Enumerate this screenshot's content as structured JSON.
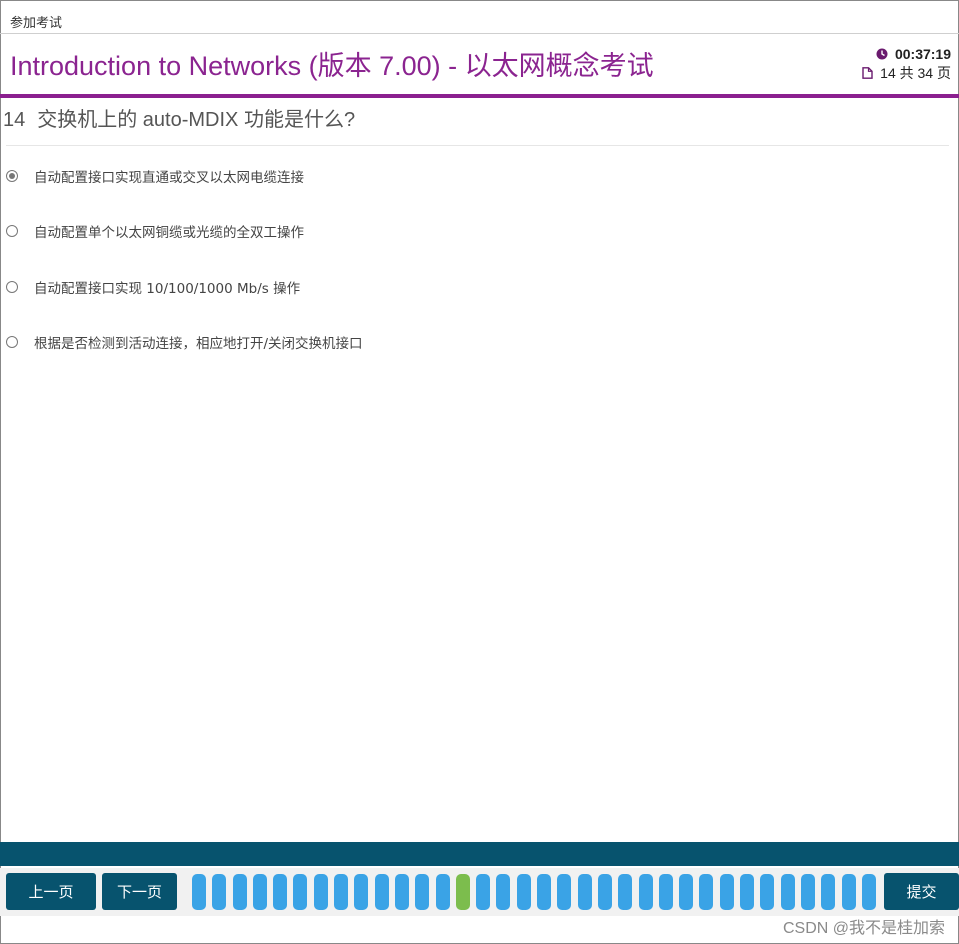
{
  "breadcrumb": "参加考试",
  "exam_title": "Introduction to Networks (版本 7.00) - 以太网概念考试",
  "timer": {
    "icon": "clock-icon",
    "value": "00:37:19"
  },
  "pages": {
    "icon": "page-icon",
    "text": "14 共 34 页"
  },
  "question": {
    "number": "14",
    "text": "交换机上的 auto-MDIX 功能是什么?"
  },
  "options": [
    {
      "label": "自动配置接口实现直通或交叉以太网电缆连接",
      "selected": true
    },
    {
      "label": "自动配置单个以太网铜缆或光缆的全双工操作",
      "selected": false
    },
    {
      "label": "自动配置接口实现 10/100/1000 Mb/s 操作",
      "selected": false
    },
    {
      "label": "根据是否检测到活动连接，相应地打开/关闭交换机接口",
      "selected": false
    }
  ],
  "nav": {
    "prev_label": "上一页",
    "next_label": "下一页",
    "submit_label": "提交",
    "total_questions": 34,
    "current_question": 14
  },
  "colors": {
    "accent": "#8b2490",
    "nav_bg": "#07536e",
    "question_dot": "#3aa3e6",
    "current_dot": "#7cbd4d"
  },
  "watermark": "CSDN @我不是桂加索"
}
